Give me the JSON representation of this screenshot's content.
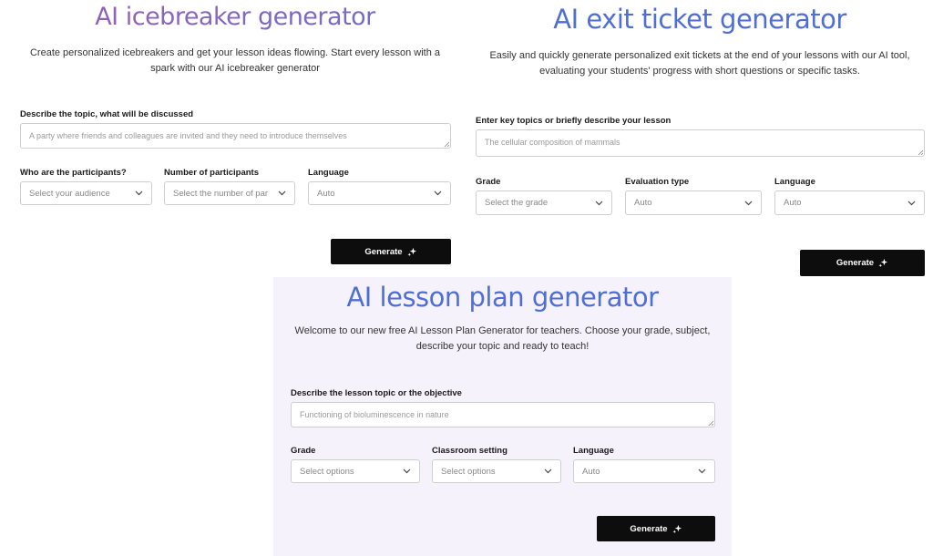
{
  "icebreaker": {
    "title": "AI icebreaker generator",
    "description": "Create personalized icebreakers and get your lesson ideas flowing. Start every lesson with a spark with our AI icebreaker generator",
    "topic_label": "Describe the topic, what will be discussed",
    "topic_placeholder": "A party where friends and colleagues are invited and they need to introduce themselves",
    "participants_label": "Who are the participants?",
    "participants_value": "Select your audience",
    "number_label": "Number of participants",
    "number_value": "Select the number of par",
    "language_label": "Language",
    "language_value": "Auto",
    "generate_label": "Generate"
  },
  "exit_ticket": {
    "title": "AI exit ticket generator",
    "description": "Easily and quickly generate personalized exit tickets at the end of your lessons with our AI tool, evaluating your students' progress with short questions or specific tasks.",
    "topic_label": "Enter key topics or briefly describe your lesson",
    "topic_placeholder": "The cellular composition of mammals",
    "grade_label": "Grade",
    "grade_value": "Select the grade",
    "evaluation_label": "Evaluation type",
    "evaluation_value": "Auto",
    "language_label": "Language",
    "language_value": "Auto",
    "generate_label": "Generate"
  },
  "lesson_plan": {
    "title": "AI lesson plan generator",
    "description": "Welcome to our new free AI Lesson Plan Generator for teachers. Choose your grade, subject, describe your topic and ready to teach!",
    "topic_label": "Describe the lesson topic or the objective",
    "topic_placeholder": "Functioning of bioluminescence in nature",
    "grade_label": "Grade",
    "grade_value": "Select options",
    "classroom_label": "Classroom setting",
    "classroom_value": "Select options",
    "language_label": "Language",
    "language_value": "Auto",
    "generate_label": "Generate"
  },
  "colors": {
    "title_blue": "#4f6ed6",
    "title_purple": "#8a5fb8",
    "button_black": "#0d0d0d",
    "lesson_panel_bg": "#f6f2fb"
  }
}
